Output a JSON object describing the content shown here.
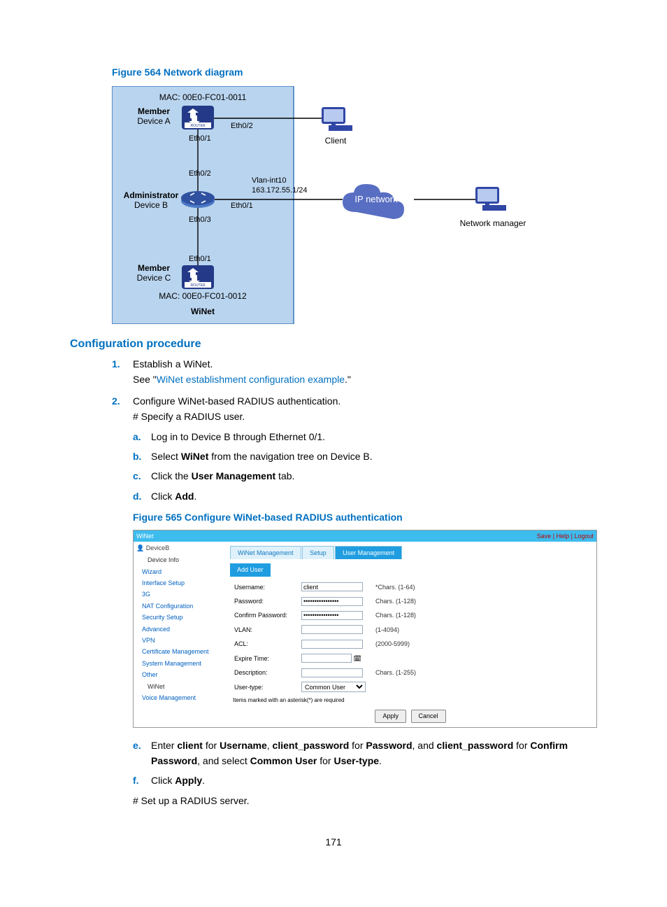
{
  "figure1": {
    "title": "Figure 564 Network diagram",
    "mac_a": "MAC: 00E0-FC01-0011",
    "member_a1": "Member",
    "member_a2": "Device A",
    "eth02_a": "Eth0/2",
    "eth01_a": "Eth0/1",
    "eth02_b": "Eth0/2",
    "vlan": "Vlan-int10",
    "ip": "163.172.55.1/24",
    "admin1": "Administrator",
    "admin2": "Device B",
    "eth01_b": "Eth0/1",
    "eth03_b": "Eth0/3",
    "eth01_c": "Eth0/1",
    "member_c1": "Member",
    "member_c2": "Device C",
    "mac_c": "MAC: 00E0-FC01-0012",
    "winet": "WiNet",
    "client": "Client",
    "ipnet": "IP network",
    "nm": "Network manager",
    "router": "ROUTER"
  },
  "proc_title": "Configuration procedure",
  "step1": {
    "num": "1.",
    "line1": "Establish a WiNet.",
    "see_pre": "See \"",
    "see_link": "WiNet establishment configuration example",
    "see_post": ".\""
  },
  "step2": {
    "num": "2.",
    "line1": "Configure WiNet-based RADIUS authentication.",
    "line2": "# Specify a RADIUS user.",
    "a": {
      "lab": "a.",
      "text": "Log in to Device B through Ethernet 0/1."
    },
    "b": {
      "lab": "b.",
      "pre": "Select ",
      "bold": "WiNet",
      "post": " from the navigation tree on Device B."
    },
    "c": {
      "lab": "c.",
      "pre": "Click the ",
      "bold": "User Management",
      "post": " tab."
    },
    "d": {
      "lab": "d.",
      "pre": "Click ",
      "bold": "Add",
      "post": "."
    },
    "e": {
      "lab": "e.",
      "t1": "Enter ",
      "b1": "client",
      "t2": " for ",
      "b2": "Username",
      "t3": ", ",
      "b3": "client_password",
      "t4": " for ",
      "b4": "Password",
      "t5": ", and ",
      "b5": "client_password",
      "t6": " for ",
      "b6": "Confirm Password",
      "t7": ", and select ",
      "b7": "Common User",
      "t8": " for ",
      "b8": "User-type",
      "t9": "."
    },
    "f": {
      "lab": "f.",
      "pre": "Click ",
      "bold": "Apply",
      "post": "."
    },
    "line3": "# Set up a RADIUS server."
  },
  "figure2": {
    "title": "Figure 565 Configure WiNet-based RADIUS authentication"
  },
  "screenshot": {
    "title": "WiNet",
    "links": "Save | Help | Logout",
    "devhdr": "DeviceB",
    "nav": {
      "i0": "Device Info",
      "i1": "Wizard",
      "i2": "Interface Setup",
      "i3": "3G",
      "i4": "NAT Configuration",
      "i5": "Security Setup",
      "i6": "Advanced",
      "i7": "VPN",
      "i8": "Certificate Management",
      "i9": "System Management",
      "i10": "Other",
      "i11": "WiNet",
      "i12": "Voice Management"
    },
    "tabs": {
      "t0": "WiNet Management",
      "t1": "Setup",
      "t2": "User Management"
    },
    "adduser": "Add User",
    "form": {
      "username_l": "Username:",
      "username_v": "client",
      "username_h": "*Chars. (1-64)",
      "password_l": "Password:",
      "password_v": "••••••••••••••••",
      "password_h": "Chars. (1-128)",
      "confirm_l": "Confirm Password:",
      "confirm_v": "••••••••••••••••",
      "confirm_h": "Chars. (1-128)",
      "vlan_l": "VLAN:",
      "vlan_h": "(1-4094)",
      "acl_l": "ACL:",
      "acl_h": "(2000-5999)",
      "expire_l": "Expire Time:",
      "desc_l": "Description:",
      "desc_h": "Chars. (1-255)",
      "utype_l": "User-type:",
      "utype_v": "Common User"
    },
    "note": "Items marked with an asterisk(*) are required",
    "apply": "Apply",
    "cancel": "Cancel"
  },
  "page_num": "171"
}
